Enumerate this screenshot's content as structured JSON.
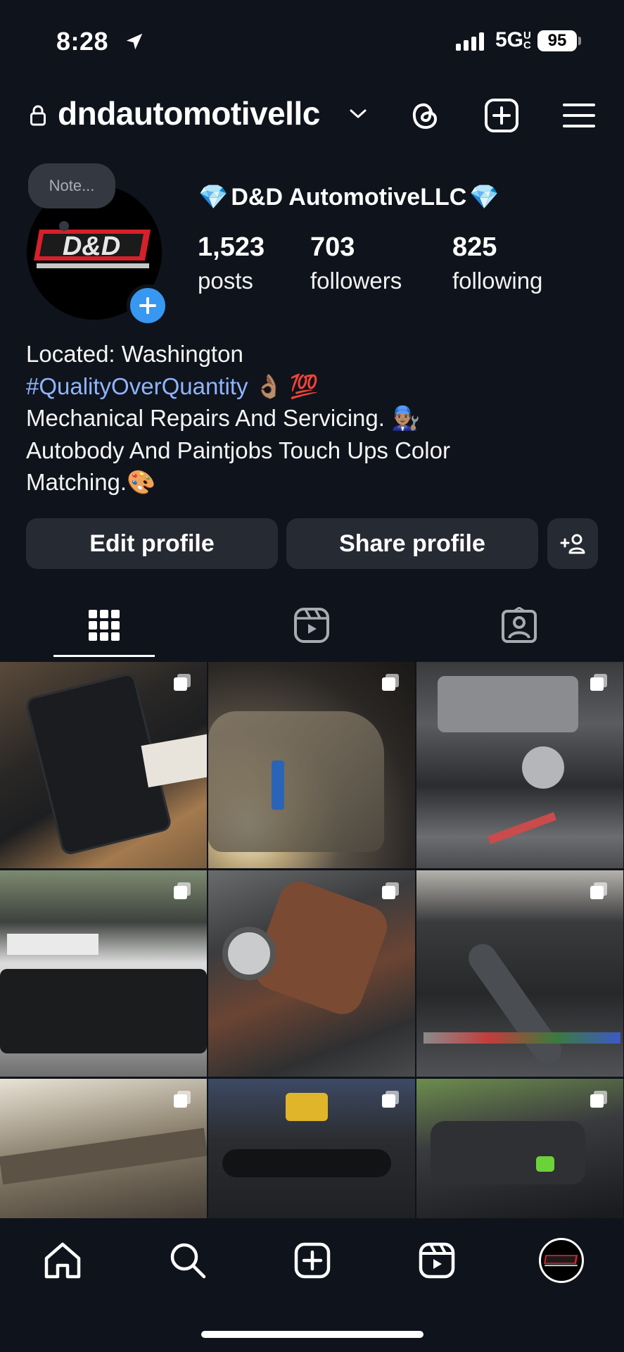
{
  "status_bar": {
    "time": "8:28",
    "network": "5G",
    "network_sub": "UC",
    "battery": "95"
  },
  "header": {
    "username": "dndautomotivellc"
  },
  "note": {
    "placeholder": "Note..."
  },
  "profile": {
    "display_name": "D&D AutomotiveLLC",
    "name_emoji": "💎",
    "avatar_logo_text": "D&D",
    "stats": [
      {
        "value": "1,523",
        "label": "posts"
      },
      {
        "value": "703",
        "label": "followers"
      },
      {
        "value": "825",
        "label": "following"
      }
    ],
    "bio": {
      "line1": "Located: Washington",
      "hashtag": "#QualityOverQuantity",
      "hashtag_emoji": "👌🏽 💯",
      "line3": "Mechanical Repairs And Servicing.",
      "line3_emoji": "👨🏽‍🔧",
      "line4": "Autobody And Paintjobs Touch Ups Color",
      "line5": "Matching.",
      "line5_emoji": "🎨"
    }
  },
  "actions": {
    "edit_label": "Edit profile",
    "share_label": "Share profile"
  },
  "tabs": [
    {
      "icon": "grid-icon",
      "active": true
    },
    {
      "icon": "reels-icon",
      "active": false
    },
    {
      "icon": "tagged-icon",
      "active": false
    }
  ],
  "posts": [
    {
      "subject": "valve cover on cardboard box",
      "multi": true
    },
    {
      "subject": "car hood open at night",
      "multi": true
    },
    {
      "subject": "engine bay with throttle body",
      "multi": true
    },
    {
      "subject": "white Nissan Xterra hood open",
      "multi": true
    },
    {
      "subject": "rusty exhaust manifold",
      "multi": true
    },
    {
      "subject": "engine bay with tools",
      "multi": true
    },
    {
      "subject": "open hood tan truck",
      "multi": true
    },
    {
      "subject": "engine with yellow drill",
      "multi": true
    },
    {
      "subject": "dark car engine bay",
      "multi": true
    }
  ],
  "bottom_nav": [
    "home-icon",
    "search-icon",
    "create-icon",
    "reels-icon",
    "profile-avatar"
  ],
  "colors": {
    "background": "#0f131b",
    "button": "#262a33",
    "link": "#8fb4ff",
    "accent": "#3897f0",
    "logo_red": "#d6202a"
  }
}
